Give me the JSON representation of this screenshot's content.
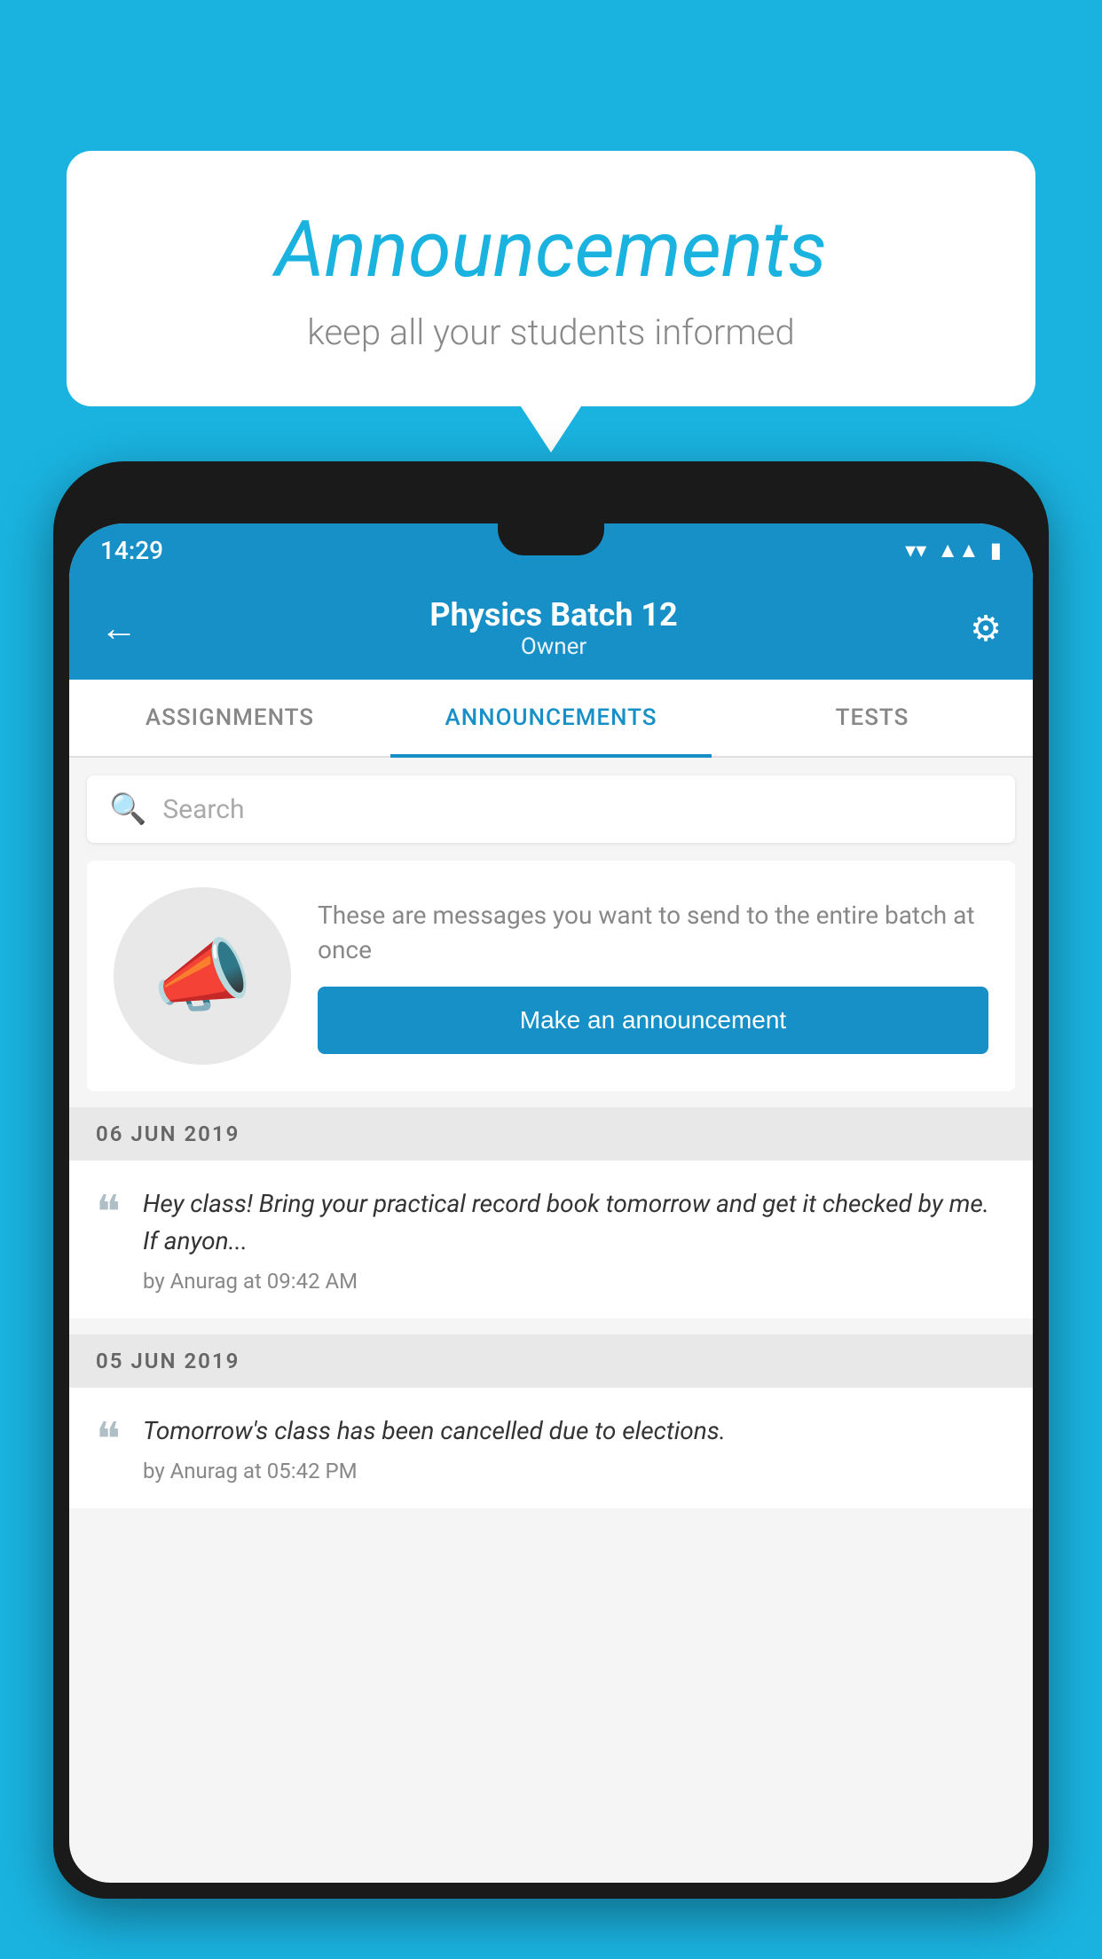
{
  "background_color": "#1ab3e0",
  "speech_bubble": {
    "title": "Announcements",
    "subtitle": "keep all your students informed"
  },
  "phone": {
    "status_bar": {
      "time": "14:29",
      "icons": [
        "wifi",
        "signal",
        "battery"
      ]
    },
    "header": {
      "title": "Physics Batch 12",
      "subtitle": "Owner"
    },
    "tabs": [
      {
        "label": "ASSIGNMENTS",
        "active": false
      },
      {
        "label": "ANNOUNCEMENTS",
        "active": true
      },
      {
        "label": "TESTS",
        "active": false
      }
    ],
    "search": {
      "placeholder": "Search"
    },
    "announcement_prompt": {
      "description": "These are messages you want to send to the entire batch at once",
      "button_label": "Make an announcement"
    },
    "announcements": [
      {
        "date": "06  JUN  2019",
        "text": "Hey class! Bring your practical record book tomorrow and get it checked by me. If anyon...",
        "meta": "by Anurag at 09:42 AM"
      },
      {
        "date": "05  JUN  2019",
        "text": "Tomorrow's class has been cancelled due to elections.",
        "meta": "by Anurag at 05:42 PM"
      }
    ]
  }
}
